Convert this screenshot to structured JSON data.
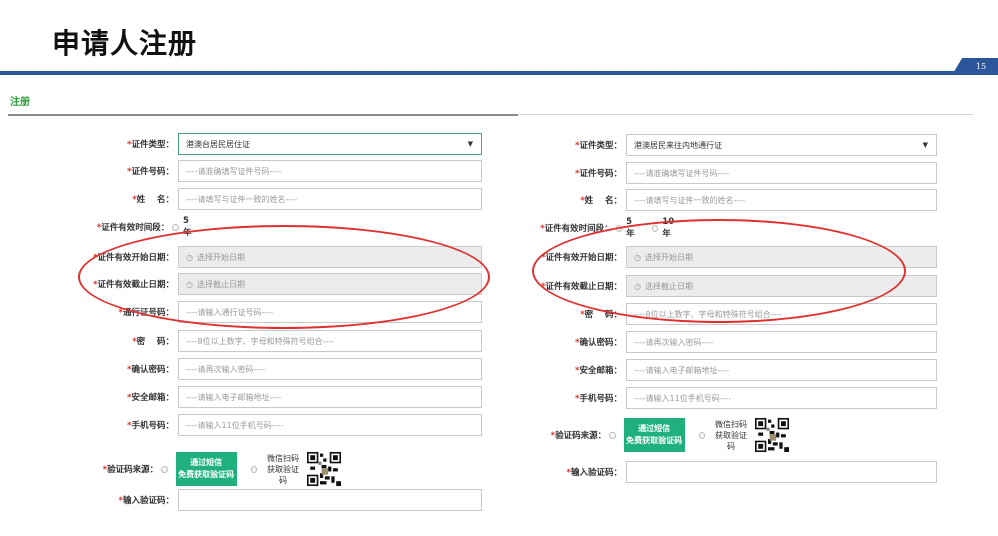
{
  "slide": {
    "title": "申请人注册",
    "page_number": "15"
  },
  "section": {
    "title": "注册"
  },
  "left_form": {
    "id_type": {
      "label": "证件类型：",
      "value": "港澳台居民居住证"
    },
    "id_number": {
      "label": "证件号码：",
      "placeholder": "----请准确填写证件号码----"
    },
    "name": {
      "label": "姓    名：",
      "placeholder": "----请填写与证件一致的姓名----"
    },
    "validity_period": {
      "label": "证件有效时间段：",
      "options": [
        "5年"
      ]
    },
    "valid_start": {
      "label": "证件有效开始日期：",
      "placeholder": "选择开始日期"
    },
    "valid_end": {
      "label": "证件有效截止日期：",
      "placeholder": "选择截止日期"
    },
    "permit_number": {
      "label": "通行证号码：",
      "placeholder": "----请输入通行证号码----"
    },
    "password": {
      "label": "密    码：",
      "placeholder": "----8位以上数字、字母和特殊符号组合----"
    },
    "confirm_password": {
      "label": "确认密码：",
      "placeholder": "----请再次输入密码----"
    },
    "email": {
      "label": "安全邮箱：",
      "placeholder": "----请输入电子邮箱地址----"
    },
    "phone": {
      "label": "手机号码：",
      "placeholder": "----请输入11位手机号码----"
    },
    "code_source": {
      "label": "验证码来源：",
      "sms_line1": "通过短信",
      "sms_line2": "免费获取验证码",
      "wx_line1": "微信扫码",
      "wx_line2": "获取验证码"
    },
    "input_code": {
      "label": "输入验证码："
    }
  },
  "right_form": {
    "id_type": {
      "label": "证件类型：",
      "value": "港澳居民来往内地通行证"
    },
    "id_number": {
      "label": "证件号码：",
      "placeholder": "----请准确填写证件号码----"
    },
    "name": {
      "label": "姓    名：",
      "placeholder": "----请填写与证件一致的姓名----"
    },
    "validity_period": {
      "label": "证件有效时间段：",
      "options": [
        "5年",
        "10年"
      ]
    },
    "valid_start": {
      "label": "证件有效开始日期：",
      "placeholder": "选择开始日期"
    },
    "valid_end": {
      "label": "证件有效截止日期：",
      "placeholder": "选择截止日期"
    },
    "password": {
      "label": "密    码：",
      "placeholder": "----8位以上数字、字母和特殊符号组合----"
    },
    "confirm_password": {
      "label": "确认密码：",
      "placeholder": "----请再次输入密码----"
    },
    "email": {
      "label": "安全邮箱：",
      "placeholder": "----请输入电子邮箱地址----"
    },
    "phone": {
      "label": "手机号码：",
      "placeholder": "----请输入11位手机号码----"
    },
    "code_source": {
      "label": "验证码来源：",
      "sms_line1": "通过短信",
      "sms_line2": "免费获取验证码",
      "wx_line1": "微信扫码",
      "wx_line2": "获取验证码"
    },
    "input_code": {
      "label": "输入验证码："
    }
  },
  "colors": {
    "accent_blue": "#2b579a",
    "section_green": "#2a9d3a",
    "sms_button": "#1fb07d",
    "annotation_red": "#e03030",
    "required_star": "#d9342b"
  },
  "icons": {
    "clock": "clock-icon",
    "dropdown": "caret-down-icon",
    "qr": "qr-code-icon"
  }
}
